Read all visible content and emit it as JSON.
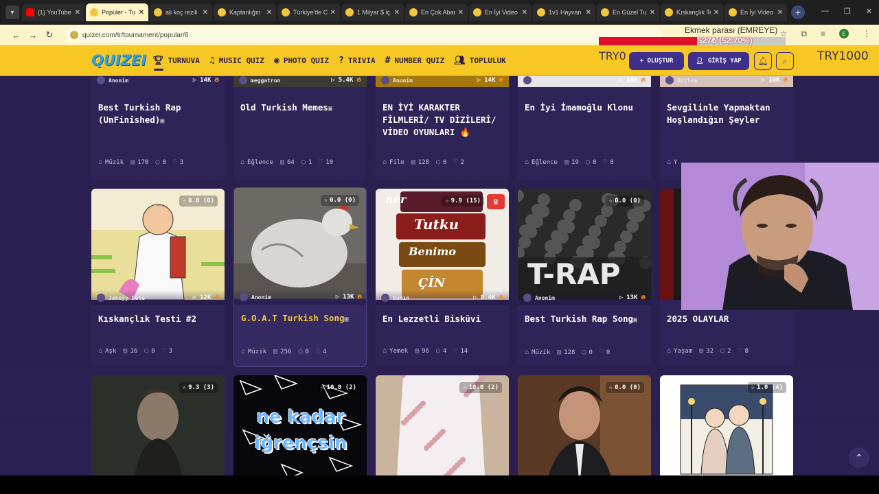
{
  "browser": {
    "tabs": [
      {
        "label": "(1) YouTube",
        "icon": "youtube-icon"
      },
      {
        "label": "Popüler - Tu",
        "icon": "quizei-icon",
        "active": true
      },
      {
        "label": "ali koç rezili",
        "icon": "quizei-icon"
      },
      {
        "label": "Kaptanlığın",
        "icon": "quizei-icon"
      },
      {
        "label": "Türkiye'de C",
        "icon": "quizei-icon"
      },
      {
        "label": "1 Milyar $ iç",
        "icon": "quizei-icon"
      },
      {
        "label": "En Çok Abar",
        "icon": "quizei-icon"
      },
      {
        "label": "En İyi Video",
        "icon": "quizei-icon"
      },
      {
        "label": "1v1 Hayvan",
        "icon": "quizei-icon"
      },
      {
        "label": "En Güzel Tu",
        "icon": "quizei-icon"
      },
      {
        "label": "Kıskançlık Te",
        "icon": "quizei-icon"
      },
      {
        "label": "En İyi Video",
        "icon": "quizei-icon"
      }
    ],
    "url": "quizei.com/tr/tournament/popular/6",
    "profile_initial": "E"
  },
  "overlay": {
    "donation_text": "Ekmek parası (EMREYE)",
    "progress_text": "527₺ (52.70%)",
    "progress_fraction": 0.527,
    "try_left": "TRY0",
    "try_right": "TRY1000"
  },
  "site": {
    "logo": "QUIZEI",
    "nav": [
      {
        "label": "TURNUVA",
        "icon": "trophy-icon"
      },
      {
        "label": "MUSIC QUIZ",
        "icon": "music-note-icon"
      },
      {
        "label": "PHOTO QUIZ",
        "icon": "camera-icon"
      },
      {
        "label": "TRIVIA",
        "icon": "chat-question-icon"
      },
      {
        "label": "NUMBER QUIZ",
        "icon": "hash-icon"
      },
      {
        "label": "TOPLULUK",
        "icon": "users-icon"
      }
    ],
    "create_label": "+ OLUŞTUR",
    "login_label": "GİRİŞ YAP"
  },
  "cards_row1": [
    {
      "author": "Anonim",
      "plays": "14K",
      "title": "Best Turkish Rap (UnFinished)",
      "video": true,
      "category": "Müzik",
      "items": "170",
      "comments": "0",
      "likes": "3"
    },
    {
      "author": "meggatron",
      "plays": "5.4K",
      "title": "Old Turkish Memes",
      "video": true,
      "category": "Eğlence",
      "items": "64",
      "comments": "1",
      "likes": "10"
    },
    {
      "author": "Anonim",
      "plays": "14K",
      "title": "EN İYİ KARAKTER FİLMLERİ/ TV DİZİLERİ/ VİDEO OYUNLARI 🔥",
      "video": false,
      "category": "Film",
      "items": "128",
      "comments": "0",
      "likes": "2"
    },
    {
      "author": "Anonim",
      "plays": "14K",
      "title": "En İyi İmamoğlu Klonu",
      "video": false,
      "category": "Eğlence",
      "items": "19",
      "comments": "0",
      "likes": "8"
    },
    {
      "author": "Ozzlem",
      "plays": "10K",
      "title": "Sevgilinle Yapmaktan Hoşlandığın Şeyler",
      "video": false,
      "category": "Y",
      "items": "",
      "comments": "",
      "likes": ""
    }
  ],
  "cards_row2": [
    {
      "rating": "0.0 (0)",
      "author": "Jekeyy Batu",
      "plays": "12K",
      "title": "Kıskançlık Testi #2",
      "video": false,
      "category": "Aşk",
      "items": "16",
      "comments": "0",
      "likes": "3"
    },
    {
      "rating": "0.0 (0)",
      "author": "Anonim",
      "plays": "13K",
      "title": "G.O.A.T Turkish Song",
      "video": true,
      "category": "Müzik",
      "items": "256",
      "comments": "0",
      "likes": "4"
    },
    {
      "rating": "9.9 (15)",
      "author": "Batın",
      "plays": "8.4K",
      "title": "En Lezzetli Bisküvi",
      "video": false,
      "category": "Yemek",
      "items": "96",
      "comments": "4",
      "likes": "14"
    },
    {
      "rating": "0.0 (0)",
      "author": "Anonim",
      "plays": "13K",
      "title": "Best Turkish Rap Song",
      "video": true,
      "category": "Müzik",
      "items": "128",
      "comments": "0",
      "likes": "0"
    },
    {
      "rating": "",
      "author": "",
      "plays": "",
      "title": "2025 OLAYLAR",
      "video": false,
      "category": "Yaşam",
      "items": "32",
      "comments": "2",
      "likes": "8"
    }
  ],
  "cards_row3": [
    {
      "rating": "9.3 (3)"
    },
    {
      "rating": "10.0 (2)",
      "image_text": "ne kadar iğrençsin"
    },
    {
      "rating": "10.0 (2)"
    },
    {
      "rating": "0.0 (0)"
    },
    {
      "rating": "1.0 (4)"
    }
  ],
  "image_texts": {
    "tutku_brand": "Tutku",
    "benimo_brand": "Benimo",
    "ner_brand": "ner",
    "cin_brand": "ÇİN",
    "trap_text": "T-RAP"
  }
}
